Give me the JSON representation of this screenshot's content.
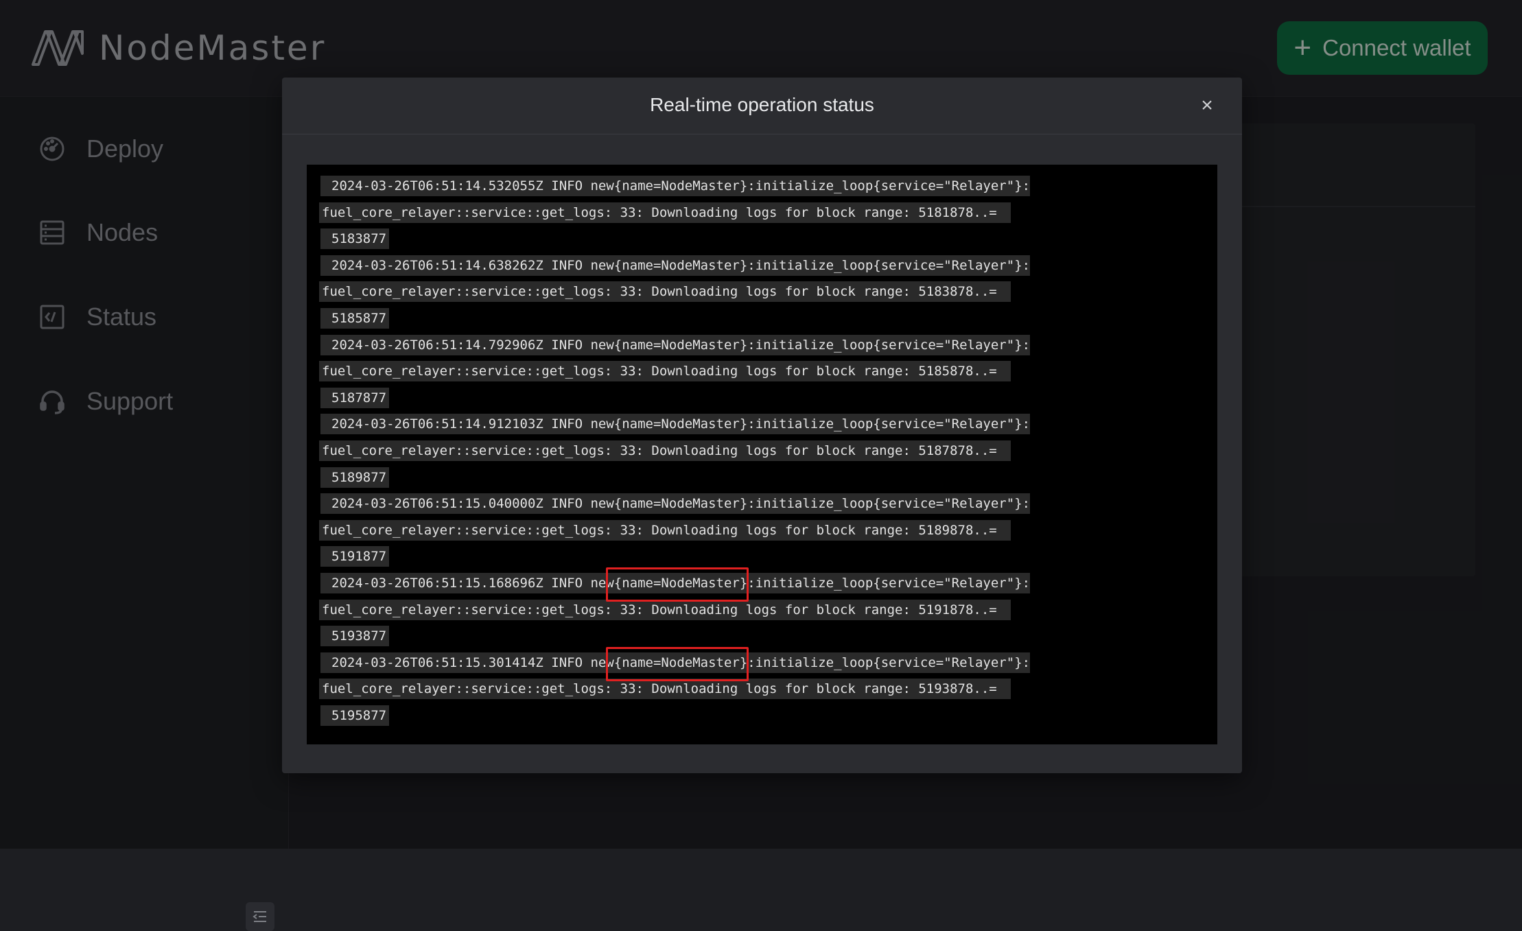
{
  "app": {
    "name": "NodeMaster",
    "connect_wallet_label": "Connect wallet"
  },
  "sidebar": {
    "items": [
      {
        "label": "Deploy",
        "icon": "dashboard-icon"
      },
      {
        "label": "Nodes",
        "icon": "server-list-icon"
      },
      {
        "label": "Status",
        "icon": "code-terminal-icon"
      },
      {
        "label": "Support",
        "icon": "headset-icon"
      }
    ]
  },
  "modal": {
    "title": "Real-time operation status",
    "close_label": "×",
    "logs": [
      {
        "line1": "2024-03-26T06:51:14.532055Z INFO new{name=NodeMaster}:initialize_loop{service=\"Relayer\"}:",
        "line2": "fuel_core_relayer::service::get_logs: 33: Downloading logs for block range: 5181878..=",
        "line3": "5183877"
      },
      {
        "line1": "2024-03-26T06:51:14.638262Z INFO new{name=NodeMaster}:initialize_loop{service=\"Relayer\"}:",
        "line2": "fuel_core_relayer::service::get_logs: 33: Downloading logs for block range: 5183878..=",
        "line3": "5185877"
      },
      {
        "line1": "2024-03-26T06:51:14.792906Z INFO new{name=NodeMaster}:initialize_loop{service=\"Relayer\"}:",
        "line2": "fuel_core_relayer::service::get_logs: 33: Downloading logs for block range: 5185878..=",
        "line3": "5187877"
      },
      {
        "line1": "2024-03-26T06:51:14.912103Z INFO new{name=NodeMaster}:initialize_loop{service=\"Relayer\"}:",
        "line2": "fuel_core_relayer::service::get_logs: 33: Downloading logs for block range: 5187878..=",
        "line3": "5189877"
      },
      {
        "line1": "2024-03-26T06:51:15.040000Z INFO new{name=NodeMaster}:initialize_loop{service=\"Relayer\"}:",
        "line2": "fuel_core_relayer::service::get_logs: 33: Downloading logs for block range: 5189878..=",
        "line3": "5191877"
      },
      {
        "line1": "2024-03-26T06:51:15.168696Z INFO new{name=NodeMaster}:initialize_loop{service=\"Relayer\"}:",
        "line2": "fuel_core_relayer::service::get_logs: 33: Downloading logs for block range: 5191878..=",
        "line3": "5193877"
      },
      {
        "line1": "2024-03-26T06:51:15.301414Z INFO new{name=NodeMaster}:initialize_loop{service=\"Relayer\"}:",
        "line2": "fuel_core_relayer::service::get_logs: 33: Downloading logs for block range: 5193878..=",
        "line3": "5195877"
      }
    ]
  },
  "colors": {
    "accent": "#0d6b3f",
    "highlight": "#e02020"
  }
}
